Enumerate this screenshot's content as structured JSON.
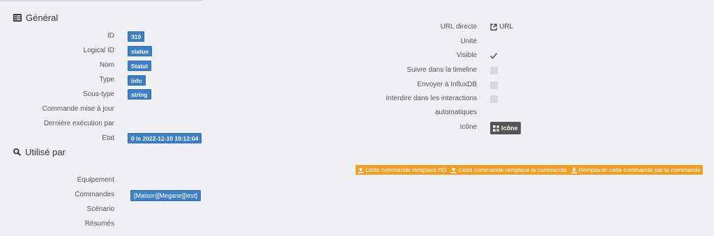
{
  "general": {
    "title": "Général",
    "fields": [
      {
        "label": "ID",
        "value": "319"
      },
      {
        "label": "Logical ID",
        "value": "status"
      },
      {
        "label": "Nom",
        "value": "Statut"
      },
      {
        "label": "Type",
        "value": "info"
      },
      {
        "label": "Sous-type",
        "value": "string"
      },
      {
        "label": "Commande mise à jour",
        "value": ""
      },
      {
        "label": "Dernière exécution par",
        "value": ""
      },
      {
        "label": "Etat",
        "value": "0 le 2022-12-10 10:12:04"
      }
    ]
  },
  "options": {
    "url_label": "URL directe",
    "url_link": "URL",
    "unite_label": "Unité",
    "visible_label": "Visible",
    "visible_checked": true,
    "timeline_label": "Suivre dans la timeline",
    "timeline_checked": false,
    "influx_label": "Envoyer à InfluxDB",
    "influx_checked": false,
    "interdire_label_1": "Interdire dans les interactions",
    "interdire_label_2": "automatiques",
    "interdire_checked": false,
    "icone_label": "Icône",
    "icone_button": "Icône"
  },
  "used_by": {
    "title": "Utilisé par",
    "equipement_label": "Equipement",
    "commandes_label": "Commandes",
    "commande_value": "[Maison][Megane][test]",
    "scenario_label": "Scénario",
    "resumes_label": "Résumés"
  },
  "actions": {
    "replace_id": "Cette commande remplace l'ID",
    "replace_cmd": "Cette commande remplace la commande",
    "replace_by": "Remplacer cette commande par la commande",
    "bar_color": "#f29f28"
  },
  "colors": {
    "badge": "#3f7fc3",
    "background": "#eef0f3",
    "icon_button": "#555555"
  }
}
